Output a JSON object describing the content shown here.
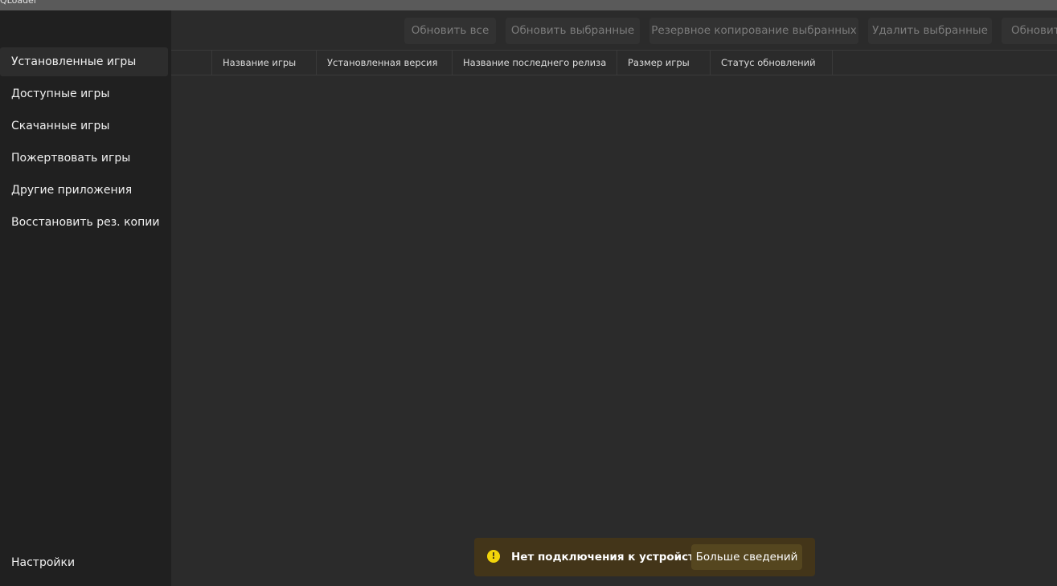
{
  "app": {
    "title": "QLoader"
  },
  "sidebar": {
    "items": [
      {
        "label": "Установленные игры"
      },
      {
        "label": "Доступные игры"
      },
      {
        "label": "Скачанные игры"
      },
      {
        "label": "Пожертвовать игры"
      },
      {
        "label": "Другие приложения"
      },
      {
        "label": "Восстановить рез. копии"
      }
    ],
    "settings_label": "Настройки"
  },
  "toolbar": {
    "update_all": "Обновить все",
    "update_selected": "Обновить выбранные",
    "backup_selected": "Резервное копирование выбранных",
    "delete_selected": "Удалить выбранные",
    "refresh": "Обновить"
  },
  "table": {
    "columns": [
      "Название игры",
      "Установленная версия",
      "Название последнего релиза",
      "Размер игры",
      "Статус обновлений"
    ]
  },
  "infobar": {
    "message": "Нет подключения к устройству",
    "action": "Больше сведений",
    "accent": "#f2d40a"
  }
}
